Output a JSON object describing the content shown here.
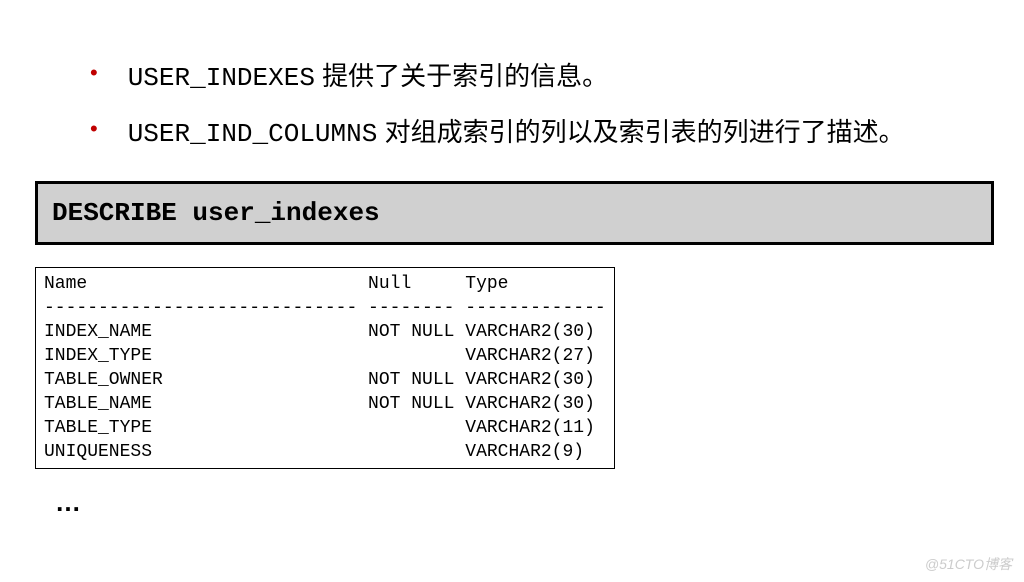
{
  "bullets": [
    {
      "code": "USER_INDEXES",
      "text": " 提供了关于索引的信息。"
    },
    {
      "code": "USER_IND_COLUMNS",
      "text": " 对组成索引的列以及索引表的列进行了描述。"
    }
  ],
  "sql_command": "DESCRIBE user_indexes",
  "output": {
    "header_line": "Name                          Null     Type",
    "separator": "----------------------------- -------- -------------",
    "rows": [
      "INDEX_NAME                    NOT NULL VARCHAR2(30)",
      "INDEX_TYPE                             VARCHAR2(27)",
      "TABLE_OWNER                   NOT NULL VARCHAR2(30)",
      "TABLE_NAME                    NOT NULL VARCHAR2(30)",
      "TABLE_TYPE                             VARCHAR2(11)",
      "UNIQUENESS                             VARCHAR2(9)"
    ]
  },
  "ellipsis": "…",
  "watermark": "@51CTO博客"
}
